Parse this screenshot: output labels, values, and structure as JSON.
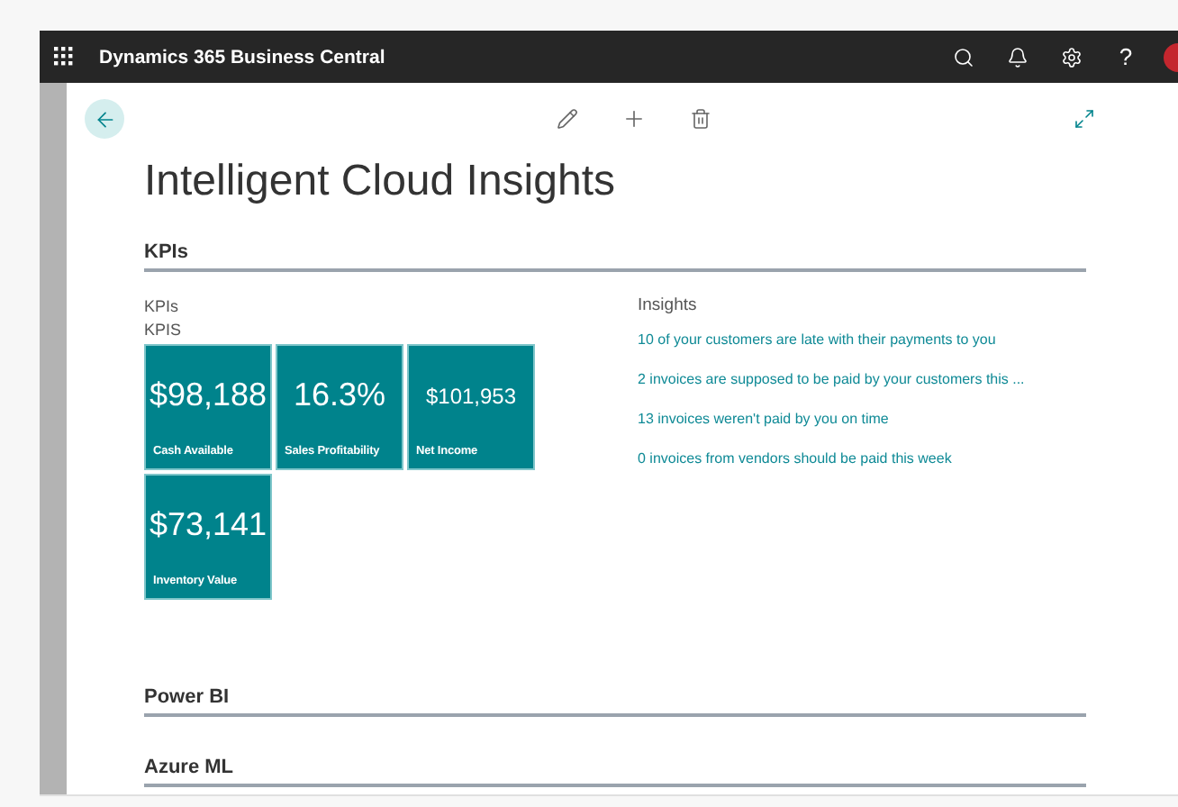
{
  "app_bar": {
    "title": "Dynamics 365 Business Central",
    "help": "?"
  },
  "page": {
    "title": "Intelligent Cloud Insights"
  },
  "sections": [
    {
      "title": "KPIs",
      "kpi_group": {
        "label": "KPIs",
        "caption": "KPIS",
        "tiles": [
          {
            "value": "$98,188",
            "label": "Cash Available"
          },
          {
            "value": "16.3%",
            "label": "Sales Profitability"
          },
          {
            "value": "$101,953",
            "label": "Net Income"
          },
          {
            "value": "$73,141",
            "label": "Inventory Value"
          }
        ]
      },
      "insights": {
        "label": "Insights",
        "links": [
          "10 of your customers are late with their payments to you",
          "2 invoices are supposed to be paid by your customers this ...",
          "13 invoices weren't paid by you on time",
          "0 invoices from vendors should be paid this week"
        ]
      }
    },
    {
      "title": "Power BI"
    },
    {
      "title": "Azure ML"
    }
  ]
}
